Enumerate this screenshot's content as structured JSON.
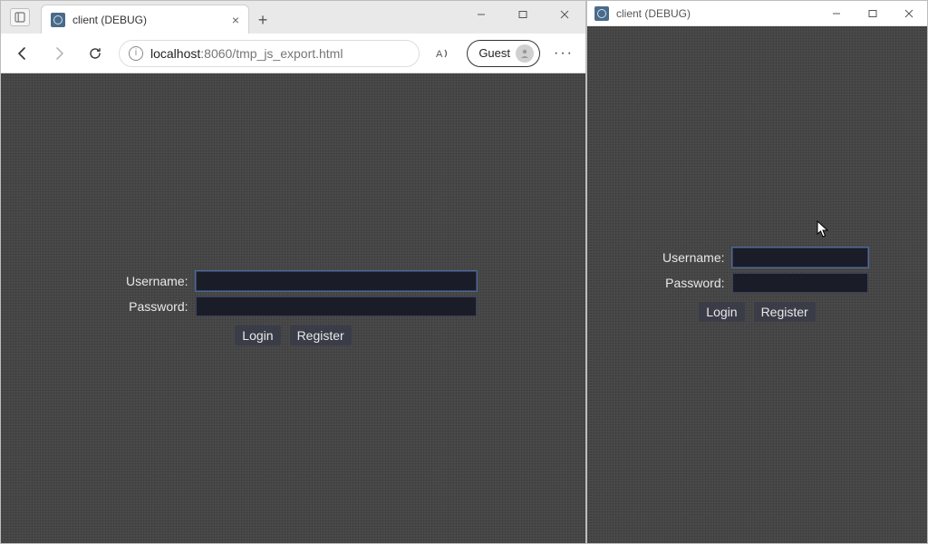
{
  "browser": {
    "tab_title": "client (DEBUG)",
    "url_host": "localhost",
    "url_port_path": ":8060/tmp_js_export.html",
    "guest_label": "Guest"
  },
  "login": {
    "username_label": "Username:",
    "password_label": "Password:",
    "login_btn": "Login",
    "register_btn": "Register"
  },
  "appwin": {
    "title": "client (DEBUG)"
  }
}
